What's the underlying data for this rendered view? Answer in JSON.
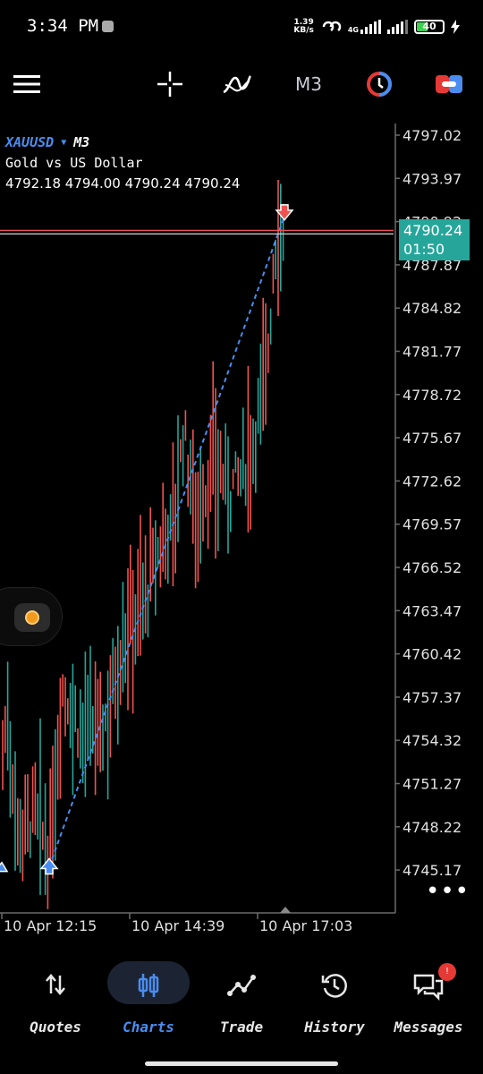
{
  "status_bar": {
    "time": "3:34 PM",
    "net_speed_value": "1.39",
    "net_speed_unit": "KB/s",
    "network_type": "4G",
    "battery_level": "40"
  },
  "toolbar": {
    "timeframe": "M3"
  },
  "chart": {
    "symbol": "XAUUSD",
    "timeframe": "M3",
    "description": "Gold vs US Dollar",
    "ohlc": "4792.18 4794.00 4790.24 4790.24",
    "current_price": "4790.24",
    "countdown": "01:50",
    "colors": {
      "bull": "#26a69a",
      "bear": "#ef5350",
      "trend_line": "#4a8df0",
      "grid": "#3a3a3a"
    }
  },
  "chart_data": {
    "type": "candlestick",
    "symbol": "XAUUSD",
    "timeframe": "M3",
    "y_ticks": [
      "4797.02",
      "4793.97",
      "4790.92",
      "4787.87",
      "4784.82",
      "4781.77",
      "4778.72",
      "4775.67",
      "4772.62",
      "4769.57",
      "4766.52",
      "4763.47",
      "4760.42",
      "4757.37",
      "4754.32",
      "4751.27",
      "4748.22",
      "4745.17"
    ],
    "x_ticks": [
      "10 Apr 12:15",
      "10 Apr 14:39",
      "10 Apr 17:03"
    ],
    "ylim": [
      4742.8,
      4798.6
    ],
    "last_price": 4790.24,
    "bid_line": 4790.3,
    "ask_line": 4790.05,
    "trend_line": {
      "start": [
        0,
        4745.4
      ],
      "end": [
        1,
        4791.3
      ]
    },
    "signals": [
      {
        "type": "buy",
        "price": 4745.4
      },
      {
        "type": "sell",
        "price": 4791.6
      }
    ]
  },
  "nav": {
    "items": [
      {
        "label": "Quotes"
      },
      {
        "label": "Charts"
      },
      {
        "label": "Trade"
      },
      {
        "label": "History"
      },
      {
        "label": "Messages"
      }
    ],
    "messages_badge": "!"
  }
}
